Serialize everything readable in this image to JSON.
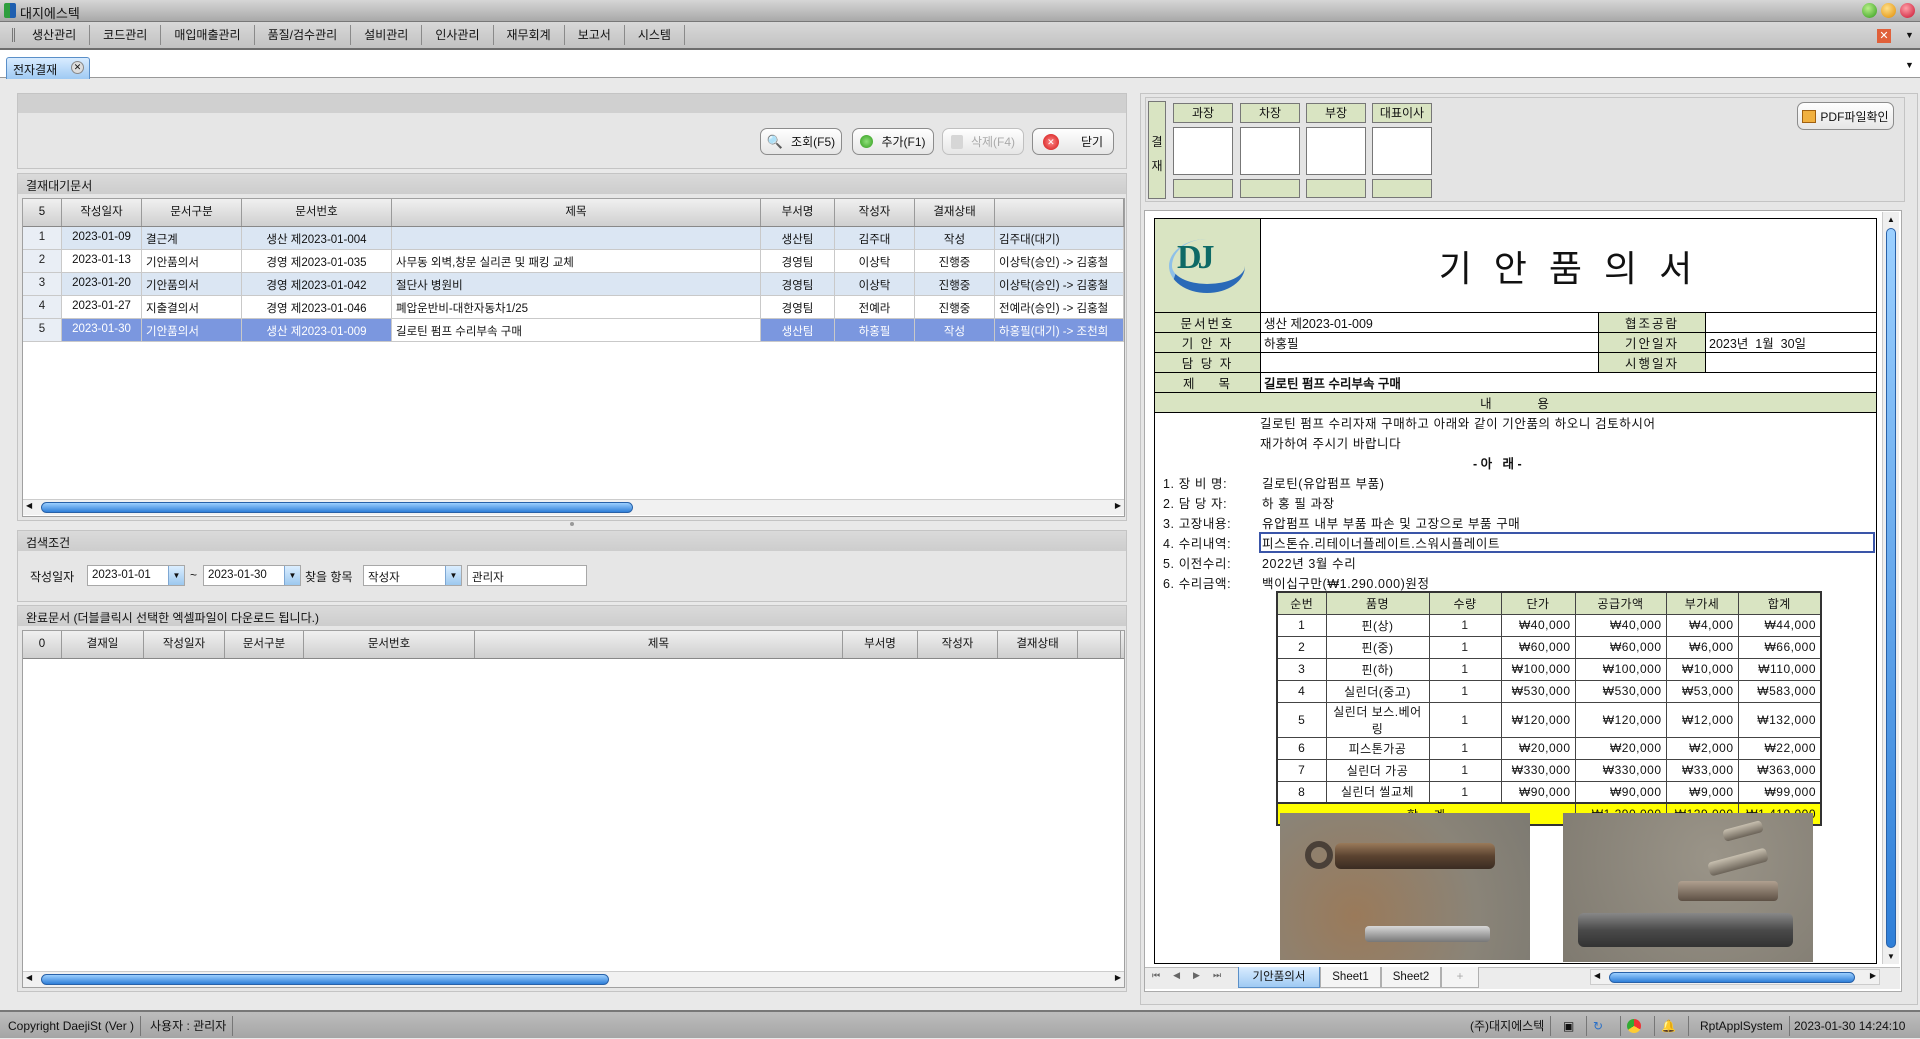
{
  "app": {
    "title": "대지에스텍"
  },
  "menu": [
    "생산관리",
    "코드관리",
    "매입매출관리",
    "품질/검수관리",
    "설비관리",
    "인사관리",
    "재무회계",
    "보고서",
    "시스템"
  ],
  "tabs": [
    {
      "label": "전자결재"
    }
  ],
  "toolbar": {
    "search": "조회(F5)",
    "add": "추가(F1)",
    "delete": "삭제(F4)",
    "close": "닫기"
  },
  "pending": {
    "title": "결재대기문서",
    "count": "5",
    "columns": [
      "작성일자",
      "문서구분",
      "문서번호",
      "제목",
      "부서명",
      "작성자",
      "결재상태",
      ""
    ],
    "rows": [
      {
        "no": "1",
        "date": "2023-01-09",
        "type": "결근계",
        "docno": "생산 제2023-01-004",
        "subject": "",
        "dept": "생산팀",
        "writer": "김주대",
        "status": "작성",
        "flow": "김주대(대기)"
      },
      {
        "no": "2",
        "date": "2023-01-13",
        "type": "기안품의서",
        "docno": "경영 제2023-01-035",
        "subject": "사무동 외벽,창문 실리콘 및 패킹 교체",
        "dept": "경영팀",
        "writer": "이상탁",
        "status": "진행중",
        "flow": "이상탁(승인) -> 김홍철"
      },
      {
        "no": "3",
        "date": "2023-01-20",
        "type": "기안품의서",
        "docno": "경영 제2023-01-042",
        "subject": "절단사 병원비",
        "dept": "경영팀",
        "writer": "이상탁",
        "status": "진행중",
        "flow": "이상탁(승인) -> 김홍철"
      },
      {
        "no": "4",
        "date": "2023-01-27",
        "type": "지출결의서",
        "docno": "경영 제2023-01-046",
        "subject": "폐압운반비-대한자동차1/25",
        "dept": "경영팀",
        "writer": "전예라",
        "status": "진행중",
        "flow": "전예라(승인) -> 김홍철"
      },
      {
        "no": "5",
        "date": "2023-01-30",
        "type": "기안품의서",
        "docno": "생산 제2023-01-009",
        "subject": "길로틴 펌프 수리부속 구매",
        "dept": "생산팀",
        "writer": "하홍필",
        "status": "작성",
        "flow": "하홍필(대기) -> 조천희",
        "selected": true
      }
    ]
  },
  "search": {
    "title": "검색조건",
    "date_label": "작성일자",
    "from": "2023-01-01",
    "sep": "~",
    "to": "2023-01-30",
    "field_label": "찾을 항목",
    "field": "작성자",
    "value": "관리자"
  },
  "done": {
    "title": "완료문서 (더블클릭시 선택한 엑셀파일이 다운로드 됩니다.)",
    "count": "0",
    "columns": [
      "결재일",
      "작성일자",
      "문서구분",
      "문서번호",
      "제목",
      "부서명",
      "작성자",
      "결재상태",
      ""
    ]
  },
  "approval": {
    "side": [
      "결",
      "재"
    ],
    "roles": [
      "과장",
      "차장",
      "부장",
      "대표이사"
    ]
  },
  "pdf_button": "PDF파일확인",
  "doc": {
    "logo": "DJ",
    "title": "기 안 품 의 서",
    "docno_label": "문서번호",
    "docno": "생산 제2023-01-009",
    "coop_label": "협조공람",
    "coop": "",
    "drafter_label": "기 안 자",
    "drafter": "하홍필",
    "draft_date_label": "기안일자",
    "draft_date": "2023년  1월  30일",
    "manager_label": "담 당 자",
    "manager": "",
    "exec_date_label": "시행일자",
    "exec_date": "",
    "subject_label": "제    목",
    "subject": "길로틴 펌프 수리부속 구매",
    "content_label": "내        용",
    "intro1": "길로틴 펌프 수리자재 구매하고 아래와 같이 기안품의 하오니 검토하시어",
    "intro2": "재가하여 주시기 바랍니다",
    "below": "- 아   래 -",
    "lines": [
      {
        "label": "1. 장 비 명:",
        "value": "길로틴(유압펌프 부품)"
      },
      {
        "label": "2. 담 당 자:",
        "value": "하 홍 필 과장"
      },
      {
        "label": "3. 고장내용:",
        "value": "유압펌프 내부 부품 파손 및 고장으로 부품 구매"
      },
      {
        "label": "4. 수리내역:",
        "value": "피스톤슈.리테이너플레이트.스워시플레이트"
      },
      {
        "label": "5. 이전수리:",
        "value": "2022년 3월 수리"
      },
      {
        "label": "6. 수리금액:",
        "value": "백이십구만(₩1.290.000)원정"
      }
    ],
    "item_columns": [
      "순번",
      "품명",
      "수량",
      "단가",
      "공급가액",
      "부가세",
      "합계"
    ],
    "items": [
      [
        "1",
        "핀(상)",
        "1",
        "₩40,000",
        "₩40,000",
        "₩4,000",
        "₩44,000"
      ],
      [
        "2",
        "핀(중)",
        "1",
        "₩60,000",
        "₩60,000",
        "₩6,000",
        "₩66,000"
      ],
      [
        "3",
        "핀(하)",
        "1",
        "₩100,000",
        "₩100,000",
        "₩10,000",
        "₩110,000"
      ],
      [
        "4",
        "실린더(중고)",
        "1",
        "₩530,000",
        "₩530,000",
        "₩53,000",
        "₩583,000"
      ],
      [
        "5",
        "실린더 보스.베어링",
        "1",
        "₩120,000",
        "₩120,000",
        "₩12,000",
        "₩132,000"
      ],
      [
        "6",
        "피스톤가공",
        "1",
        "₩20,000",
        "₩20,000",
        "₩2,000",
        "₩22,000"
      ],
      [
        "7",
        "실린더 가공",
        "1",
        "₩330,000",
        "₩330,000",
        "₩33,000",
        "₩363,000"
      ],
      [
        "8",
        "실린더 씰교체",
        "1",
        "₩90,000",
        "₩90,000",
        "₩9,000",
        "₩99,000"
      ]
    ],
    "total_label": "합    계",
    "total_supply": "₩1,290,000",
    "total_vat": "₩129,000",
    "total_sum": "₩1,419,000"
  },
  "sheets": [
    "기안품의서",
    "Sheet1",
    "Sheet2",
    "+"
  ],
  "status": {
    "copyright": "Copyright DaejiSt (Ver )",
    "user": "사용자 : 관리자",
    "company": "(주)대지에스텍",
    "system": "RptApplSystem",
    "datetime": "2023-01-30 14:24:10"
  },
  "colors": {
    "selected_row": "#7b97df",
    "alt_row": "#dbe6f3",
    "label_bg": "#d9e4c2",
    "total_bg": "#ffff00"
  }
}
